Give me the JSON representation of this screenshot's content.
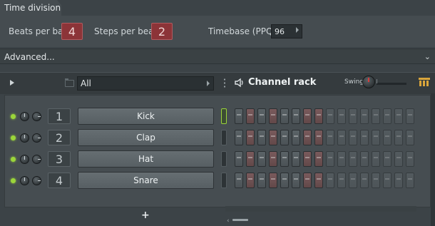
{
  "time_division": {
    "title": "Time division",
    "beats_per_bar_label": "Beats per bar",
    "beats_per_bar": "4",
    "steps_per_beat_label": "Steps per beat",
    "steps_per_beat": "2",
    "timebase_label": "Timebase (PPQ)",
    "timebase": "96"
  },
  "advanced": {
    "label": "Advanced..."
  },
  "channel_rack": {
    "filter": "All",
    "title": "Channel rack",
    "swing_label": "Swing",
    "add_label": "+",
    "channels": [
      {
        "number": "1",
        "name": "Kick",
        "selected": true
      },
      {
        "number": "2",
        "name": "Clap",
        "selected": false
      },
      {
        "number": "3",
        "name": "Hat",
        "selected": false
      },
      {
        "number": "4",
        "name": "Snare",
        "selected": false
      }
    ]
  },
  "colors": {
    "accent_led": "#9bd53a",
    "value_box": "#8c3438",
    "swing_marker": "#d43c3c"
  },
  "icons": [
    "play-icon",
    "folder-icon",
    "menu-dots-icon",
    "speaker-icon",
    "swing-knob",
    "graph-icon",
    "chevron-down-icon"
  ]
}
